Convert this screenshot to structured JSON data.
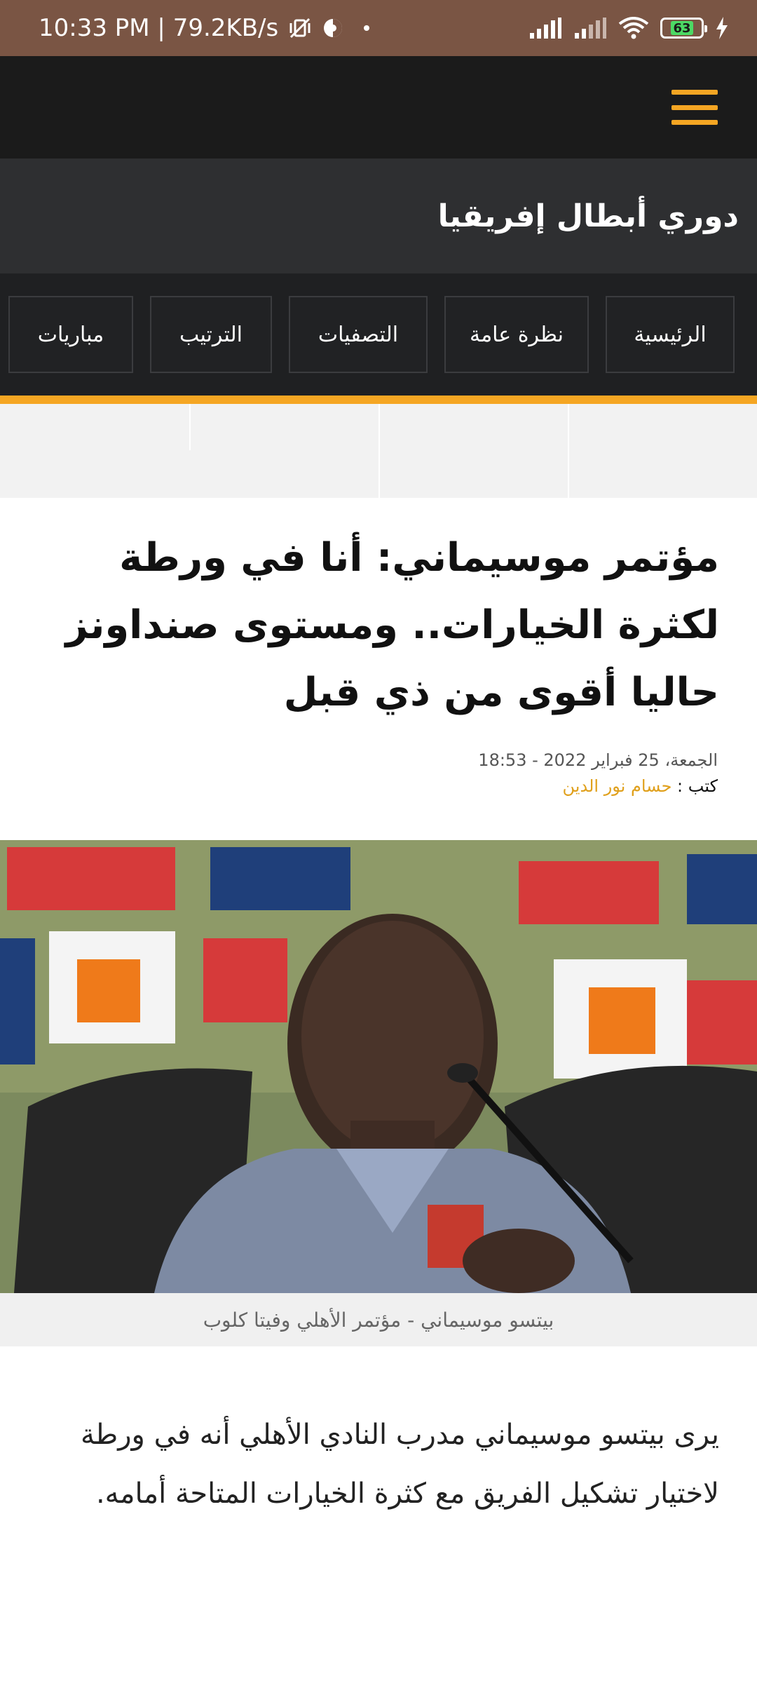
{
  "status_bar": {
    "time_speed": "10:33 PM | 79.2KB/s",
    "battery": "63",
    "icons": [
      "vibrate-off-icon",
      "data-saver-icon",
      "dot-icon",
      "signal-icon",
      "signal-icon",
      "wifi-icon",
      "battery-icon",
      "charging-icon"
    ]
  },
  "header": {
    "menu_icon": "hamburger-menu-icon",
    "accent_color": "#f5a623"
  },
  "league": {
    "title": "دوري أبطال إفريقيا"
  },
  "nav": {
    "tabs": [
      {
        "label": "الرئيسية"
      },
      {
        "label": "نظرة عامة"
      },
      {
        "label": "التصفيات"
      },
      {
        "label": "الترتيب"
      },
      {
        "label": "مباريات"
      }
    ]
  },
  "article": {
    "title": "مؤتمر موسيماني: أنا في ورطة لكثرة الخيارات.. ومستوى صنداونز حاليا أقوى من ذي قبل",
    "date": "الجمعة، 25 فبراير 2022 - 18:53",
    "author_label": "كتب :",
    "author_name": "حسام نور الدين",
    "image_caption": "بيتسو موسيماني - مؤتمر الأهلي وفيتا كلوب",
    "body": "يرى بيتسو موسيماني مدرب النادي الأهلي أنه في ورطة لاختيار تشكيل الفريق مع كثرة الخيارات المتاحة أمامه."
  }
}
